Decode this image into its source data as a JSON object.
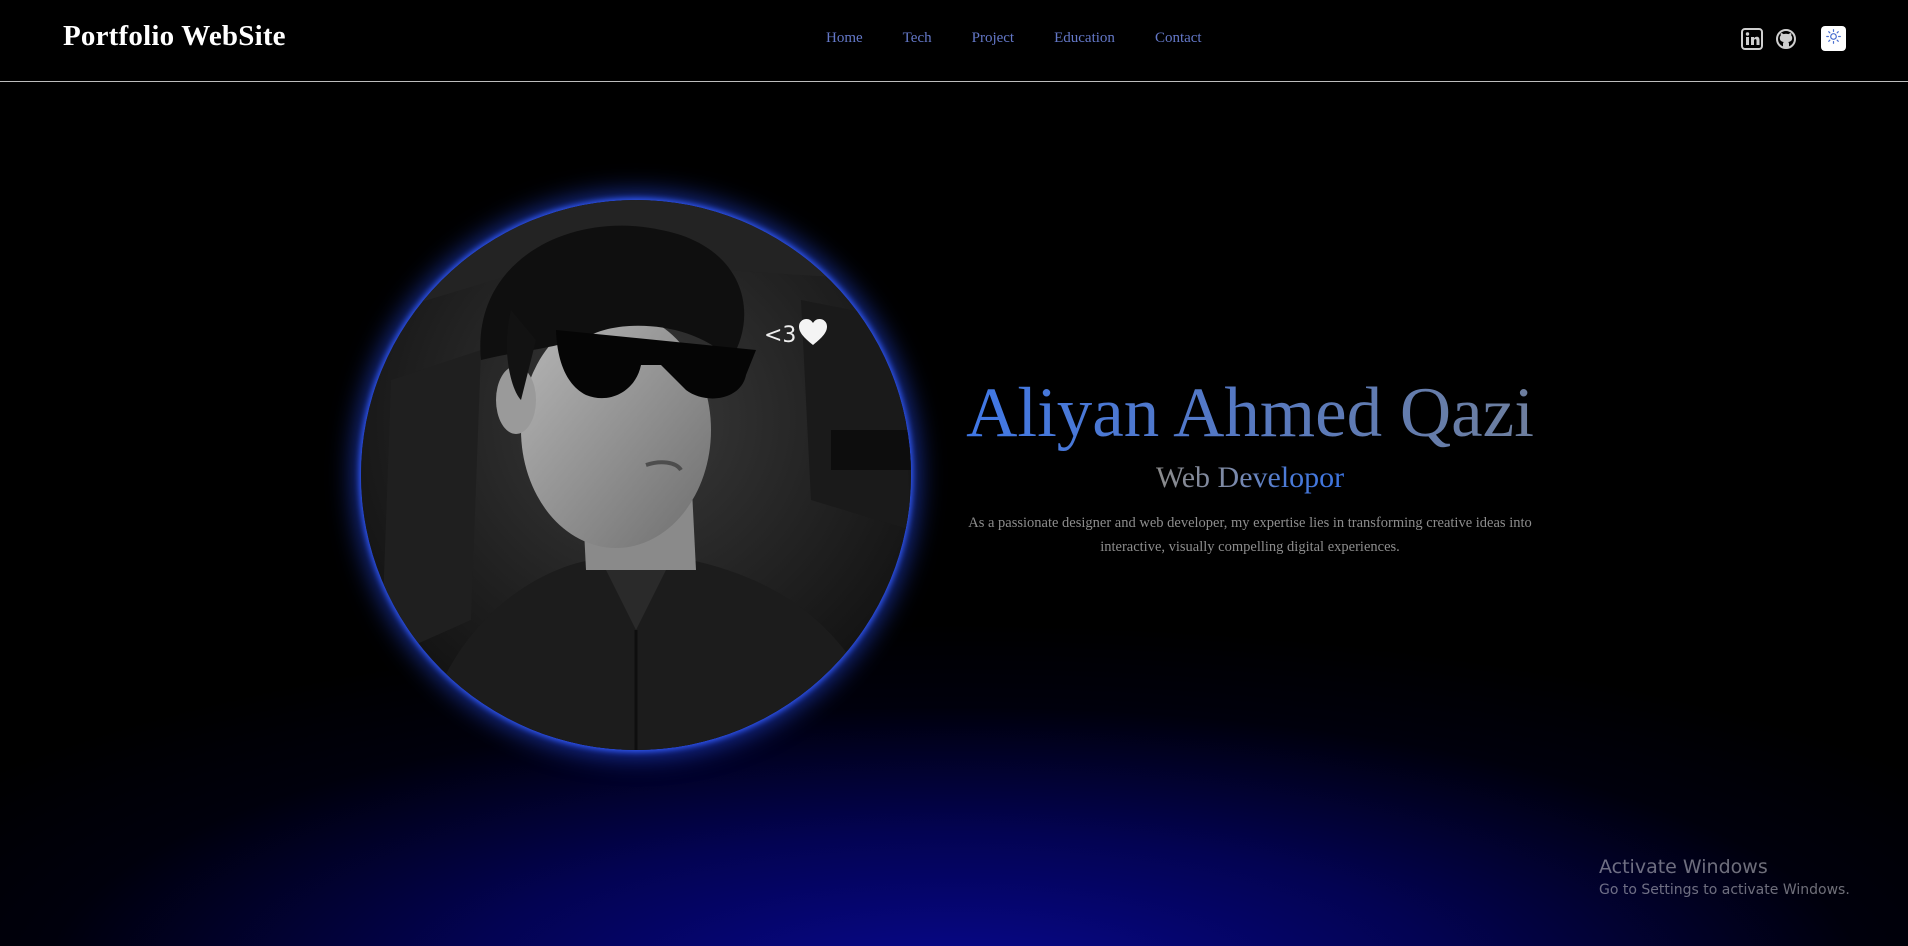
{
  "header": {
    "brand": "Portfolio WebSite",
    "nav": [
      {
        "label": "Home"
      },
      {
        "label": "Tech"
      },
      {
        "label": "Project"
      },
      {
        "label": "Education"
      },
      {
        "label": "Contact"
      }
    ],
    "social_icons": [
      "linkedin-icon",
      "github-icon"
    ],
    "theme_icon": "sun-icon"
  },
  "hero": {
    "avatar_caption": "<3",
    "avatar_caption_icon": "heart-icon",
    "name": "Aliyan Ahmed Qazi",
    "role": "Web Developor",
    "bio": "As a passionate designer and web developer, my expertise lies in transforming creative ideas into interactive, visually compelling digital experiences."
  },
  "watermark": {
    "title": "Activate Windows",
    "subtitle": "Go to Settings to activate Windows."
  },
  "colors": {
    "accent_blue": "#3f78e8",
    "nav_link": "#6478c8",
    "background": "#000000",
    "glow": "#0808a0"
  }
}
